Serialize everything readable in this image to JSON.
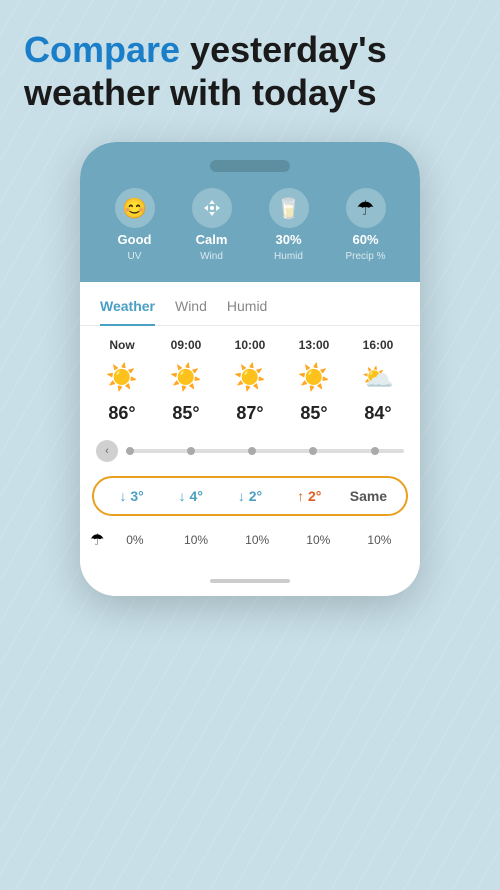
{
  "header": {
    "line1_highlight": "Compare",
    "line1_rest": " yesterday's",
    "line2": "weather with today's"
  },
  "phone": {
    "status_icons": [
      {
        "icon": "😊",
        "value": "Good",
        "label": "UV"
      },
      {
        "icon": "🌬",
        "value": "Calm",
        "label": "Wind"
      },
      {
        "icon": "💧",
        "value": "30%",
        "label": "Humid"
      },
      {
        "icon": "☂",
        "value": "60%",
        "label": "Precip %"
      }
    ],
    "tabs": [
      "Weather",
      "Wind",
      "Humid"
    ],
    "active_tab": 0,
    "time_labels": [
      "Now",
      "09:00",
      "10:00",
      "13:00",
      "16:00"
    ],
    "weather_icons": [
      "☀️",
      "☀️",
      "☀️",
      "☀️",
      "⛅"
    ],
    "temperatures": [
      "86°",
      "85°",
      "87°",
      "85°",
      "84°"
    ],
    "comparisons": [
      "↓ 3°",
      "↓ 4°",
      "↓ 2°",
      "↑ 2°",
      "Same"
    ],
    "comp_types": [
      "down",
      "down",
      "down",
      "up",
      "same"
    ],
    "precip_icon": "☂",
    "precip_values": [
      "0%",
      "10%",
      "10%",
      "10%",
      "10%"
    ]
  }
}
